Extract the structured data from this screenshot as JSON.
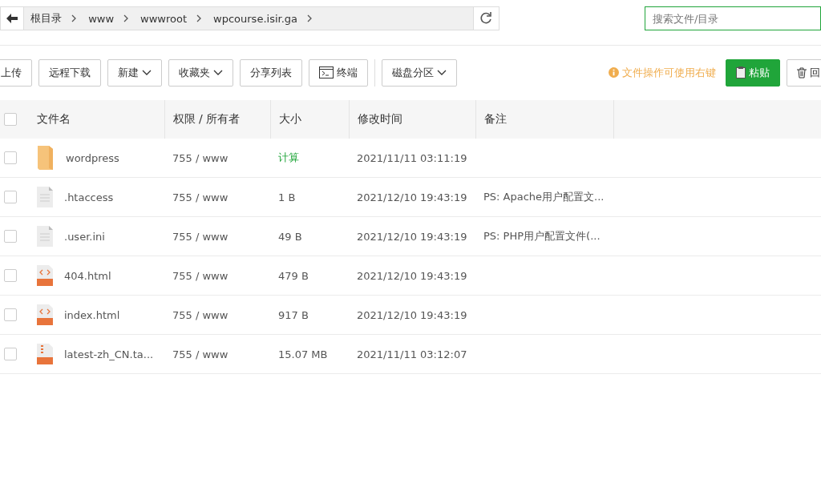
{
  "breadcrumb": [
    "根目录",
    "www",
    "wwwroot",
    "wpcourse.isir.ga"
  ],
  "search": {
    "placeholder": "搜索文件/目录"
  },
  "toolbar": {
    "buttons": [
      {
        "label": "上传",
        "kind": "plain"
      },
      {
        "label": "远程下载",
        "kind": "plain"
      },
      {
        "label": "新建",
        "kind": "dropdown"
      },
      {
        "label": "收藏夹",
        "kind": "dropdown"
      },
      {
        "label": "分享列表",
        "kind": "plain"
      },
      {
        "label": "终端",
        "kind": "terminal"
      },
      {
        "label": "磁盘分区",
        "kind": "dropdown"
      }
    ],
    "hint": "文件操作可使用右键",
    "paste_button": "粘贴",
    "recycle_button": "回"
  },
  "table": {
    "select_all_checked": false,
    "columns": [
      "文件名",
      "权限 / 所有者",
      "大小",
      "修改时间",
      "备注"
    ],
    "rows": [
      {
        "kind": "folder",
        "checked": false,
        "name": "wordpress",
        "perm": "755 / www",
        "size": "计算",
        "mtime": "2021/11/11 03:11:19"
      },
      {
        "kind": "text",
        "checked": false,
        "name": ".htaccess",
        "perm": "755 / www",
        "size": "1 B",
        "mtime": "2021/12/10 19:43:19",
        "note": "PS: Apache用户配置文..."
      },
      {
        "kind": "text",
        "checked": false,
        "name": ".user.ini",
        "perm": "755 / www",
        "size": "49 B",
        "mtime": "2021/12/10 19:43:19",
        "note": "PS: PHP用户配置文件(..."
      },
      {
        "kind": "html",
        "checked": false,
        "name": "404.html",
        "perm": "755 / www",
        "size": "479 B",
        "mtime": "2021/12/10 19:43:19"
      },
      {
        "kind": "html",
        "checked": false,
        "name": "index.html",
        "perm": "755 / www",
        "size": "917 B",
        "mtime": "2021/12/10 19:43:19"
      },
      {
        "kind": "tar",
        "checked": false,
        "name": "latest-zh_CN.ta...",
        "perm": "755 / www",
        "size": "15.07 MB",
        "mtime": "2021/11/11 03:12:07"
      }
    ]
  }
}
